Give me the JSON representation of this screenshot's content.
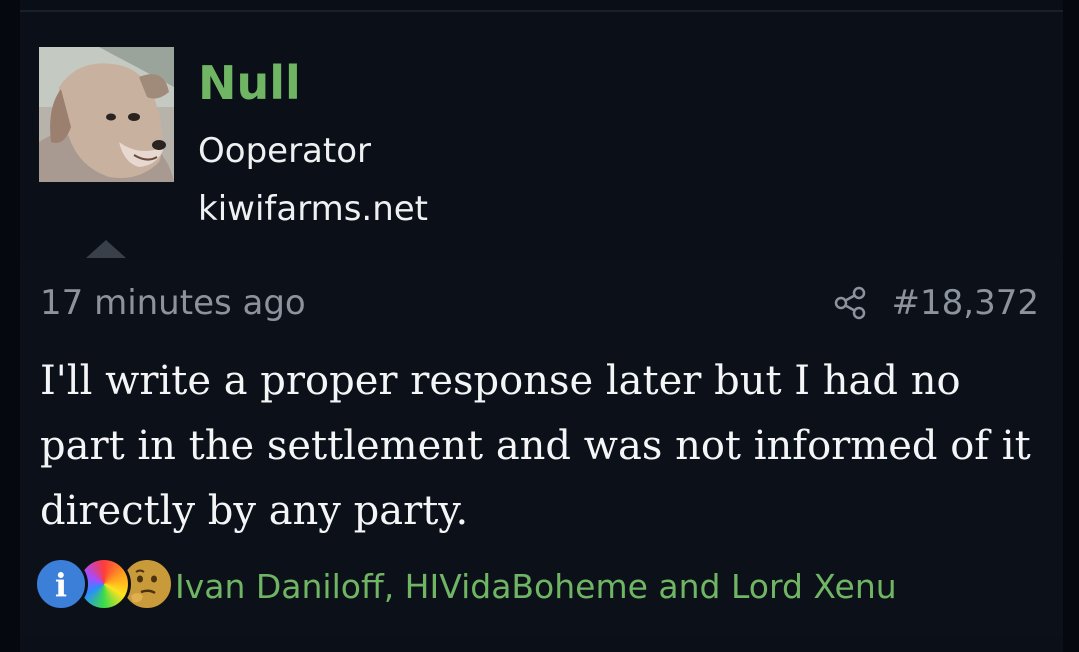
{
  "user": {
    "name": "Null",
    "title": "Ooperator",
    "extra": "kiwifarms.net",
    "avatar_icon": "dog-avatar"
  },
  "post": {
    "timestamp": "17 minutes ago",
    "number": "#18,372",
    "message": "I'll write a proper response later but I had no part in the settlement and was not informed of it directly by any party.",
    "share_icon": "share-icon"
  },
  "reactions": {
    "icons": [
      "info-icon",
      "rainbow-icon",
      "thinking-icon"
    ],
    "reacted_by": "Ivan Daniloff, HIVidaBoheme and Lord Xenu"
  },
  "colors": {
    "username": "#6fb564",
    "background": "#0b0f17",
    "text": "#f4f5f7",
    "muted": "#8d939c"
  }
}
